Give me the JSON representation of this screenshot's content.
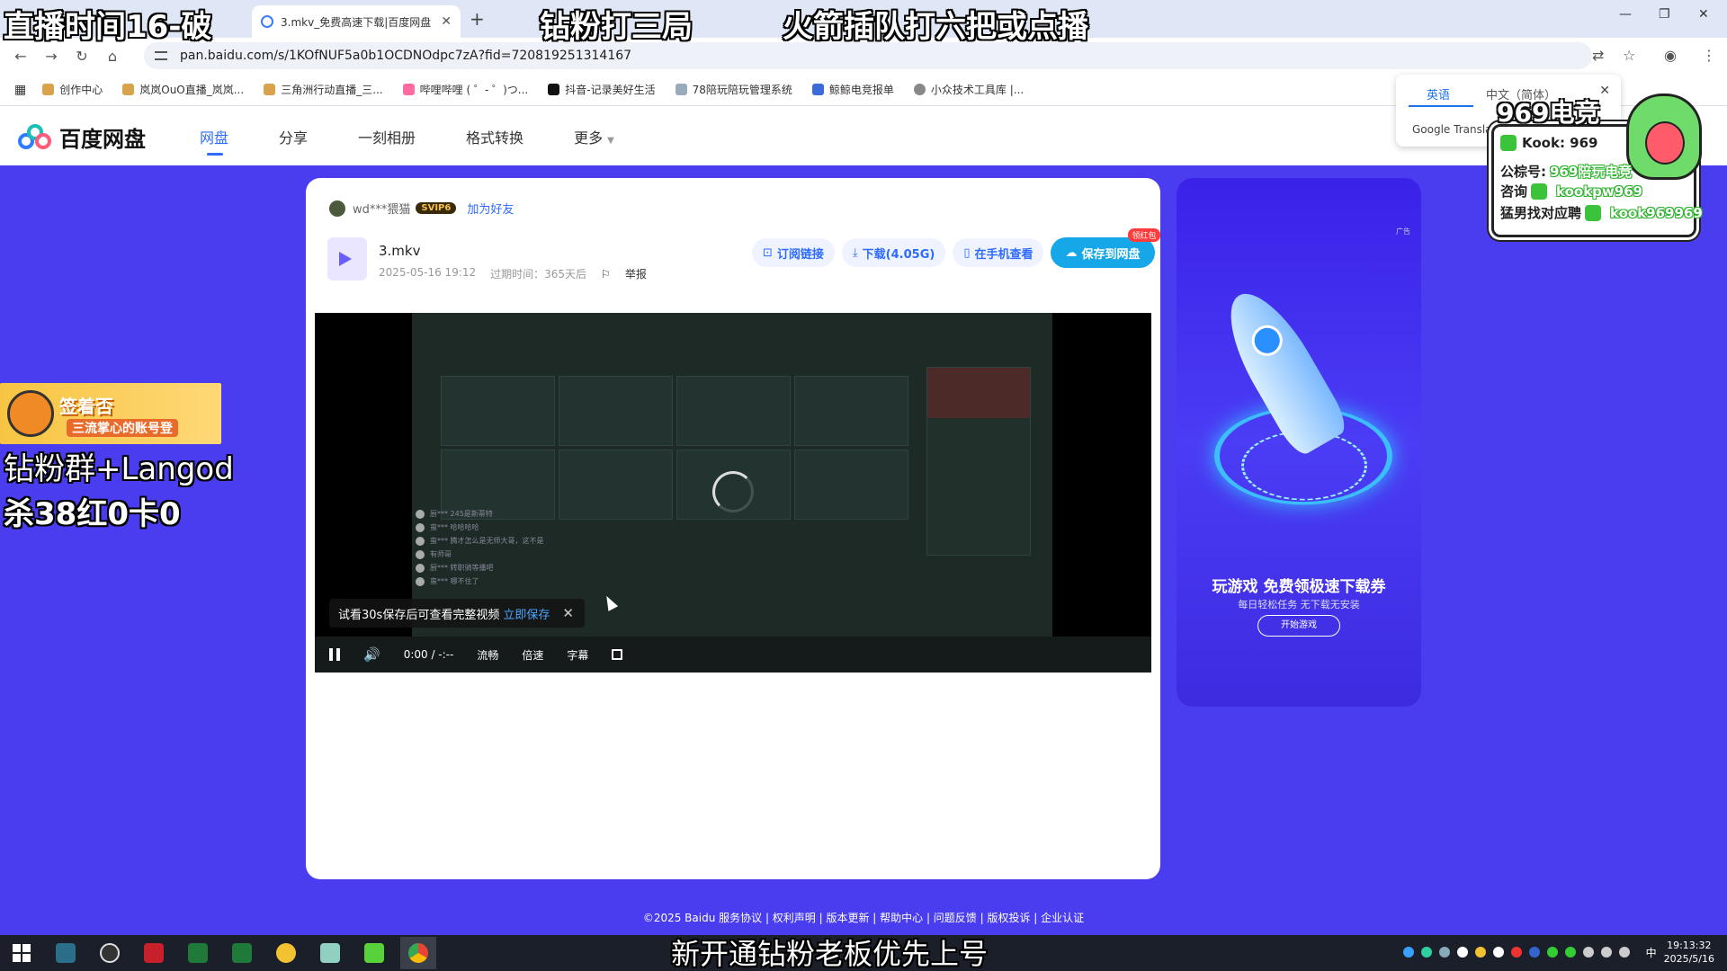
{
  "browser": {
    "tab_title": "3.mkv_免费高速下载|百度网盘",
    "url": "pan.baidu.com/s/1KOfNUF5a0b1OCDNOdpc7zA?fid=720819251314167",
    "bookmarks": [
      {
        "label": "创作中心"
      },
      {
        "label": "岚岚OuO直播_岚岚..."
      },
      {
        "label": "三角洲行动直播_三..."
      },
      {
        "label": "哔哩哔哩 ( ゜- ゜)つ..."
      },
      {
        "label": "抖音-记录美好生活"
      },
      {
        "label": "78陪玩陪玩管理系统"
      },
      {
        "label": "鲸鲸电竞报单"
      },
      {
        "label": "小众技术工具库 |..."
      }
    ],
    "translate_popup": {
      "tab_source": "英语",
      "tab_target": "中文（简体）",
      "brand": "Google Translate"
    }
  },
  "site": {
    "logo_text": "百度网盘",
    "nav": [
      "网盘",
      "分享",
      "一刻相册",
      "格式转换",
      "更多"
    ]
  },
  "share": {
    "sharer_name": "wd***猥猫",
    "svip_badge": "SVIP6",
    "add_friend": "加为好友",
    "file_name": "3.mkv",
    "date": "2025-05-16 19:12",
    "expire": "过期时间：365天后",
    "report": "举报",
    "actions": {
      "subscribe": "订阅链接",
      "download": "下载(4.05G)",
      "phone": "在手机查看",
      "save": "保存到网盘",
      "save_badge": "领红包"
    }
  },
  "player": {
    "trial_tip": "试看30s保存后可查看完整视频",
    "trial_save": "立即保存",
    "time": "0:00 / -:--",
    "quality": "流畅",
    "speed": "倍速",
    "subtitle": "字幕",
    "chat": [
      "厨*** 245是斯蒂特",
      "蛮*** 哈哈哈哈",
      "蛮*** 腾才怎么是无师大哥，这不是",
      "有师哥",
      "厨*** 转职骑等播吧",
      "蛮*** 哪不住了"
    ]
  },
  "ad": {
    "tag": "广告",
    "headline": "玩游戏 免费领极速下载券",
    "sub": "每日轻松任务 无下载无安装",
    "button": "开始游戏"
  },
  "footer": "©2025 Baidu  服务协议 | 权利声明 | 版本更新 | 帮助中心 | 问题反馈 | 版权投诉 | 企业认证",
  "overlays": {
    "top_left": "直播时间16-破",
    "top_1": "钻粉打三局",
    "top_2": "火箭插队打六把或点播",
    "sign_title": "签着否",
    "sign_sub": "三流掌心的账号登",
    "left_1": "钻粉群+Langod",
    "left_2": "杀38红0卡0",
    "bottom": "新开通钻粉老板优先上号",
    "promo_title": "969电竞",
    "promo_kook": "Kook: 969",
    "promo_gzh_label": "公棕号:",
    "promo_gzh": "969陪玩电竞",
    "promo_zx_label": "咨询",
    "promo_zx": "kookpw969",
    "promo_zp_label": "猛男找对应聘",
    "promo_zp": "kook969969"
  },
  "taskbar": {
    "time": "19:13:32",
    "date": "2025/5/16",
    "ime": "中"
  }
}
